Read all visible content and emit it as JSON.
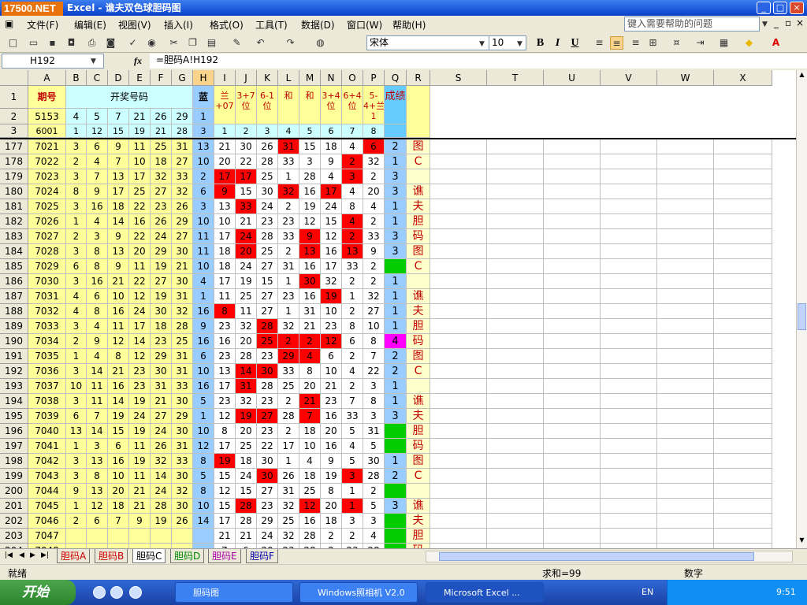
{
  "window": {
    "title": "谯夫双色球胆码图",
    "app": "Excel",
    "logo": "17500.NET",
    "min": "_",
    "max": "□",
    "close": "×"
  },
  "menu": {
    "items": [
      "文件(F)",
      "编辑(E)",
      "视图(V)",
      "插入(I)",
      "格式(O)",
      "工具(T)",
      "数据(D)",
      "窗口(W)",
      "帮助(H)"
    ],
    "help_placeholder": "键入需要帮助的问题"
  },
  "toolbar": {
    "font": "宋体",
    "size": "10",
    "bold": "B",
    "italic": "I",
    "underline": "U"
  },
  "formula": {
    "cell": "H192",
    "fx": "fx",
    "content": "=胆码A!H192"
  },
  "columns": [
    "A",
    "B",
    "C",
    "D",
    "E",
    "F",
    "G",
    "H",
    "I",
    "J",
    "K",
    "L",
    "M",
    "N",
    "O",
    "P",
    "Q",
    "R",
    "S",
    "T",
    "U",
    "V",
    "W",
    "X"
  ],
  "header": {
    "qihao": "期号",
    "kaijiang": "开奖号码",
    "lan": "蓝",
    "chengji": "成绩",
    "formulas": [
      "兰+07",
      "3+7位",
      "6-1位",
      "和",
      "和",
      "3+4位",
      "6+4位",
      "5-4+兰1"
    ],
    "row2": [
      "5153",
      "4",
      "5",
      "7",
      "21",
      "26",
      "29",
      "1"
    ],
    "row3": [
      "6001",
      "1",
      "12",
      "15",
      "19",
      "21",
      "28",
      "3"
    ],
    "row3_idx": [
      "1",
      "2",
      "3",
      "4",
      "5",
      "6",
      "7",
      "8"
    ],
    "rownums": [
      "1",
      "2",
      "3"
    ]
  },
  "rows": [
    {
      "n": "177",
      "c": [
        "7021",
        "3",
        "6",
        "9",
        "11",
        "25",
        "31",
        "13",
        "21",
        "30",
        "26",
        "31",
        "15",
        "18",
        "4",
        "6"
      ],
      "red": [
        11,
        15
      ],
      "q": "2",
      "r": "图"
    },
    {
      "n": "178",
      "c": [
        "7022",
        "2",
        "4",
        "7",
        "10",
        "18",
        "27",
        "10",
        "20",
        "22",
        "28",
        "33",
        "3",
        "9",
        "2",
        "32"
      ],
      "red": [
        14
      ],
      "q": "1",
      "r": "C"
    },
    {
      "n": "179",
      "c": [
        "7023",
        "3",
        "7",
        "13",
        "17",
        "32",
        "33",
        "2",
        "17",
        "17",
        "25",
        "1",
        "28",
        "4",
        "3",
        "2"
      ],
      "red": [
        8,
        9,
        14
      ],
      "q": "3",
      "r": ""
    },
    {
      "n": "180",
      "c": [
        "7024",
        "8",
        "9",
        "17",
        "25",
        "27",
        "32",
        "6",
        "9",
        "15",
        "30",
        "32",
        "16",
        "17",
        "4",
        "20"
      ],
      "red": [
        8,
        11,
        13
      ],
      "q": "3",
      "r": "谯"
    },
    {
      "n": "181",
      "c": [
        "7025",
        "3",
        "16",
        "18",
        "22",
        "23",
        "26",
        "3",
        "13",
        "33",
        "24",
        "2",
        "19",
        "24",
        "8",
        "4"
      ],
      "red": [
        9
      ],
      "q": "1",
      "r": "夫"
    },
    {
      "n": "182",
      "c": [
        "7026",
        "1",
        "4",
        "14",
        "16",
        "26",
        "29",
        "10",
        "10",
        "21",
        "23",
        "23",
        "12",
        "15",
        "4",
        "2"
      ],
      "red": [
        14
      ],
      "q": "1",
      "r": "胆"
    },
    {
      "n": "183",
      "c": [
        "7027",
        "2",
        "3",
        "9",
        "22",
        "24",
        "27",
        "11",
        "17",
        "24",
        "28",
        "33",
        "9",
        "12",
        "2",
        "33"
      ],
      "red": [
        9,
        12,
        14
      ],
      "q": "3",
      "r": "码"
    },
    {
      "n": "184",
      "c": [
        "7028",
        "3",
        "8",
        "13",
        "20",
        "29",
        "30",
        "11",
        "18",
        "20",
        "25",
        "2",
        "13",
        "16",
        "13",
        "9"
      ],
      "red": [
        9,
        12,
        14
      ],
      "q": "3",
      "r": "图"
    },
    {
      "n": "185",
      "c": [
        "7029",
        "6",
        "8",
        "9",
        "11",
        "19",
        "21",
        "10",
        "18",
        "24",
        "27",
        "31",
        "16",
        "17",
        "33",
        "2"
      ],
      "red": [],
      "q": "",
      "r": "C",
      "green": true
    },
    {
      "n": "186",
      "c": [
        "7030",
        "3",
        "16",
        "21",
        "22",
        "27",
        "30",
        "4",
        "17",
        "19",
        "15",
        "1",
        "30",
        "32",
        "2",
        "2"
      ],
      "red": [
        12
      ],
      "q": "1",
      "r": ""
    },
    {
      "n": "187",
      "c": [
        "7031",
        "4",
        "6",
        "10",
        "12",
        "19",
        "31",
        "1",
        "11",
        "25",
        "27",
        "23",
        "16",
        "19",
        "1",
        "32"
      ],
      "red": [
        13
      ],
      "q": "1",
      "r": "谯"
    },
    {
      "n": "188",
      "c": [
        "7032",
        "4",
        "8",
        "16",
        "24",
        "30",
        "32",
        "16",
        "8",
        "11",
        "27",
        "1",
        "31",
        "10",
        "2",
        "27"
      ],
      "red": [
        8
      ],
      "q": "1",
      "r": "夫"
    },
    {
      "n": "189",
      "c": [
        "7033",
        "3",
        "4",
        "11",
        "17",
        "18",
        "28",
        "9",
        "23",
        "32",
        "28",
        "32",
        "21",
        "23",
        "8",
        "10"
      ],
      "red": [
        10
      ],
      "q": "1",
      "r": "胆"
    },
    {
      "n": "190",
      "c": [
        "7034",
        "2",
        "9",
        "12",
        "14",
        "23",
        "25",
        "16",
        "16",
        "20",
        "25",
        "2",
        "2",
        "12",
        "6",
        "8"
      ],
      "red": [
        10,
        11,
        12,
        13
      ],
      "q": "4",
      "r": "码",
      "magenta": true
    },
    {
      "n": "191",
      "c": [
        "7035",
        "1",
        "4",
        "8",
        "12",
        "29",
        "31",
        "6",
        "23",
        "28",
        "23",
        "29",
        "4",
        "6",
        "2",
        "7"
      ],
      "red": [
        11,
        12
      ],
      "q": "2",
      "r": "图"
    },
    {
      "n": "192",
      "c": [
        "7036",
        "3",
        "14",
        "21",
        "23",
        "30",
        "31",
        "10",
        "13",
        "14",
        "30",
        "33",
        "8",
        "10",
        "4",
        "22"
      ],
      "red": [
        9,
        10
      ],
      "q": "2",
      "r": "C"
    },
    {
      "n": "193",
      "c": [
        "7037",
        "10",
        "11",
        "16",
        "23",
        "31",
        "33",
        "16",
        "17",
        "31",
        "28",
        "25",
        "20",
        "21",
        "2",
        "3"
      ],
      "red": [
        9
      ],
      "q": "1",
      "r": ""
    },
    {
      "n": "194",
      "c": [
        "7038",
        "3",
        "11",
        "14",
        "19",
        "21",
        "30",
        "5",
        "23",
        "32",
        "23",
        "2",
        "21",
        "23",
        "7",
        "8"
      ],
      "red": [
        12
      ],
      "q": "1",
      "r": "谯"
    },
    {
      "n": "195",
      "c": [
        "7039",
        "6",
        "7",
        "19",
        "24",
        "27",
        "29",
        "1",
        "12",
        "19",
        "27",
        "28",
        "7",
        "16",
        "33",
        "3"
      ],
      "red": [
        9,
        10,
        12
      ],
      "q": "3",
      "r": "夫"
    },
    {
      "n": "196",
      "c": [
        "7040",
        "13",
        "14",
        "15",
        "19",
        "24",
        "30",
        "10",
        "8",
        "20",
        "23",
        "2",
        "18",
        "20",
        "5",
        "31"
      ],
      "red": [],
      "q": "",
      "r": "胆",
      "green": true
    },
    {
      "n": "197",
      "c": [
        "7041",
        "1",
        "3",
        "6",
        "11",
        "26",
        "31",
        "12",
        "17",
        "25",
        "22",
        "17",
        "10",
        "16",
        "4",
        "5"
      ],
      "red": [],
      "q": "",
      "r": "码",
      "green": true
    },
    {
      "n": "198",
      "c": [
        "7042",
        "3",
        "13",
        "16",
        "19",
        "32",
        "33",
        "8",
        "19",
        "18",
        "30",
        "1",
        "4",
        "9",
        "5",
        "30"
      ],
      "red": [
        8
      ],
      "q": "1",
      "r": "图"
    },
    {
      "n": "199",
      "c": [
        "7043",
        "3",
        "8",
        "10",
        "11",
        "14",
        "30",
        "5",
        "15",
        "24",
        "30",
        "26",
        "18",
        "19",
        "3",
        "28"
      ],
      "red": [
        10,
        14
      ],
      "q": "2",
      "r": "C"
    },
    {
      "n": "200",
      "c": [
        "7044",
        "9",
        "13",
        "20",
        "21",
        "24",
        "32",
        "8",
        "12",
        "15",
        "27",
        "31",
        "25",
        "8",
        "1",
        "2"
      ],
      "red": [],
      "q": "",
      "r": "",
      "green": true
    },
    {
      "n": "201",
      "c": [
        "7045",
        "1",
        "12",
        "18",
        "21",
        "28",
        "30",
        "10",
        "15",
        "28",
        "23",
        "32",
        "12",
        "20",
        "1",
        "5"
      ],
      "red": [
        9,
        12,
        14
      ],
      "q": "3",
      "r": "谯"
    },
    {
      "n": "202",
      "c": [
        "7046",
        "2",
        "6",
        "7",
        "9",
        "19",
        "26",
        "14",
        "17",
        "28",
        "29",
        "25",
        "16",
        "18",
        "3",
        "3"
      ],
      "red": [],
      "q": "",
      "r": "夫",
      "green": true
    },
    {
      "n": "203",
      "c": [
        "7047",
        "",
        "",
        "",
        "",
        "",
        "",
        "",
        "21",
        "21",
        "24",
        "32",
        "28",
        "2",
        "2",
        "4"
      ],
      "red": [],
      "q": "",
      "r": "胆",
      "green": true
    },
    {
      "n": "204",
      "c": [
        "7048",
        "",
        "",
        "",
        "",
        "",
        "",
        "",
        "7",
        "6",
        "20",
        "23",
        "28",
        "2",
        "23",
        "28"
      ],
      "red": [],
      "q": "",
      "r": "码",
      "green": true
    }
  ],
  "sheets": [
    "胆码A",
    "胆码B",
    "胆码C",
    "胆码D",
    "胆码E",
    "胆码F"
  ],
  "active_sheet": 2,
  "status": {
    "ready": "就绪",
    "sum": "求和=99",
    "mode": "数字"
  },
  "taskbar": {
    "start": "开始",
    "tasks": [
      "胆码图",
      "Windows照相机 V2.0",
      "Microsoft Excel ..."
    ],
    "lang": "EN",
    "time": "9:51"
  }
}
